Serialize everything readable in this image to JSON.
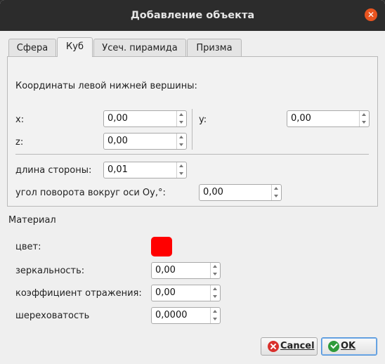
{
  "window": {
    "title": "Добавление объекта"
  },
  "tabs": [
    {
      "label": "Сфера",
      "active": false
    },
    {
      "label": "Куб",
      "active": true
    },
    {
      "label": "Усеч. пирамида",
      "active": false
    },
    {
      "label": "Призма",
      "active": false
    }
  ],
  "cube": {
    "coords_heading": "Координаты левой нижней вершины:",
    "x_label": "x:",
    "x_value": "0,00",
    "y_label": "y:",
    "y_value": "0,00",
    "z_label": "z:",
    "z_value": "0,00",
    "side_label": "длина стороны:",
    "side_value": "0,01",
    "rotation_label": "угол поворота вокруг оси Oy,°:",
    "rotation_value": "0,00"
  },
  "material": {
    "heading": "Материал",
    "color_label": "цвет:",
    "color_value": "#ff0000",
    "specular_label": "зеркальность:",
    "specular_value": "0,00",
    "reflection_label": "коэффициент отражения:",
    "reflection_value": "0,00",
    "roughness_label": "шереховатость",
    "roughness_value": "0,0000"
  },
  "buttons": {
    "cancel_label": "Cancel",
    "ok_label": "OK"
  },
  "icons": {
    "close": "close-icon",
    "cancel": "cancel-icon",
    "ok": "ok-icon",
    "spin_up": "chevron-up-icon",
    "spin_down": "chevron-down-icon"
  }
}
